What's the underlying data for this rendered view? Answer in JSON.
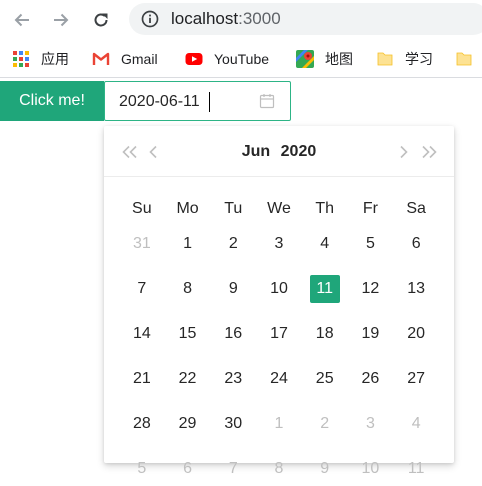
{
  "browser": {
    "url_host": "localhost",
    "url_port": ":3000",
    "bookmarks": [
      {
        "label": "应用",
        "icon": "apps-grid-icon"
      },
      {
        "label": "Gmail",
        "icon": "gmail-icon"
      },
      {
        "label": "YouTube",
        "icon": "youtube-icon"
      },
      {
        "label": "地图",
        "icon": "maps-icon"
      },
      {
        "label": "学习",
        "icon": "folder-icon"
      },
      {
        "label": "",
        "icon": "folder-icon"
      }
    ]
  },
  "page": {
    "click_button_label": "Click me!",
    "date_value": "2020-06-11"
  },
  "calendar": {
    "month": "Jun",
    "year": "2020",
    "weekdays": [
      "Su",
      "Mo",
      "Tu",
      "We",
      "Th",
      "Fr",
      "Sa"
    ],
    "weeks": [
      [
        {
          "d": "31",
          "o": true
        },
        {
          "d": "1"
        },
        {
          "d": "2"
        },
        {
          "d": "3"
        },
        {
          "d": "4"
        },
        {
          "d": "5"
        },
        {
          "d": "6"
        }
      ],
      [
        {
          "d": "7"
        },
        {
          "d": "8"
        },
        {
          "d": "9"
        },
        {
          "d": "10"
        },
        {
          "d": "11",
          "s": true
        },
        {
          "d": "12"
        },
        {
          "d": "13"
        }
      ],
      [
        {
          "d": "14"
        },
        {
          "d": "15"
        },
        {
          "d": "16"
        },
        {
          "d": "17"
        },
        {
          "d": "18"
        },
        {
          "d": "19"
        },
        {
          "d": "20"
        }
      ],
      [
        {
          "d": "21"
        },
        {
          "d": "22"
        },
        {
          "d": "23"
        },
        {
          "d": "24"
        },
        {
          "d": "25"
        },
        {
          "d": "26"
        },
        {
          "d": "27"
        }
      ],
      [
        {
          "d": "28"
        },
        {
          "d": "29"
        },
        {
          "d": "30"
        },
        {
          "d": "1",
          "o": true
        },
        {
          "d": "2",
          "o": true
        },
        {
          "d": "3",
          "o": true
        },
        {
          "d": "4",
          "o": true
        }
      ],
      [
        {
          "d": "5",
          "o": true
        },
        {
          "d": "6",
          "o": true
        },
        {
          "d": "7",
          "o": true
        },
        {
          "d": "8",
          "o": true
        },
        {
          "d": "9",
          "o": true
        },
        {
          "d": "10",
          "o": true
        },
        {
          "d": "11",
          "o": true
        }
      ]
    ]
  },
  "colors": {
    "accent": "#1fa67a",
    "input_border": "#2db486",
    "muted_day": "#bfbfbf"
  }
}
